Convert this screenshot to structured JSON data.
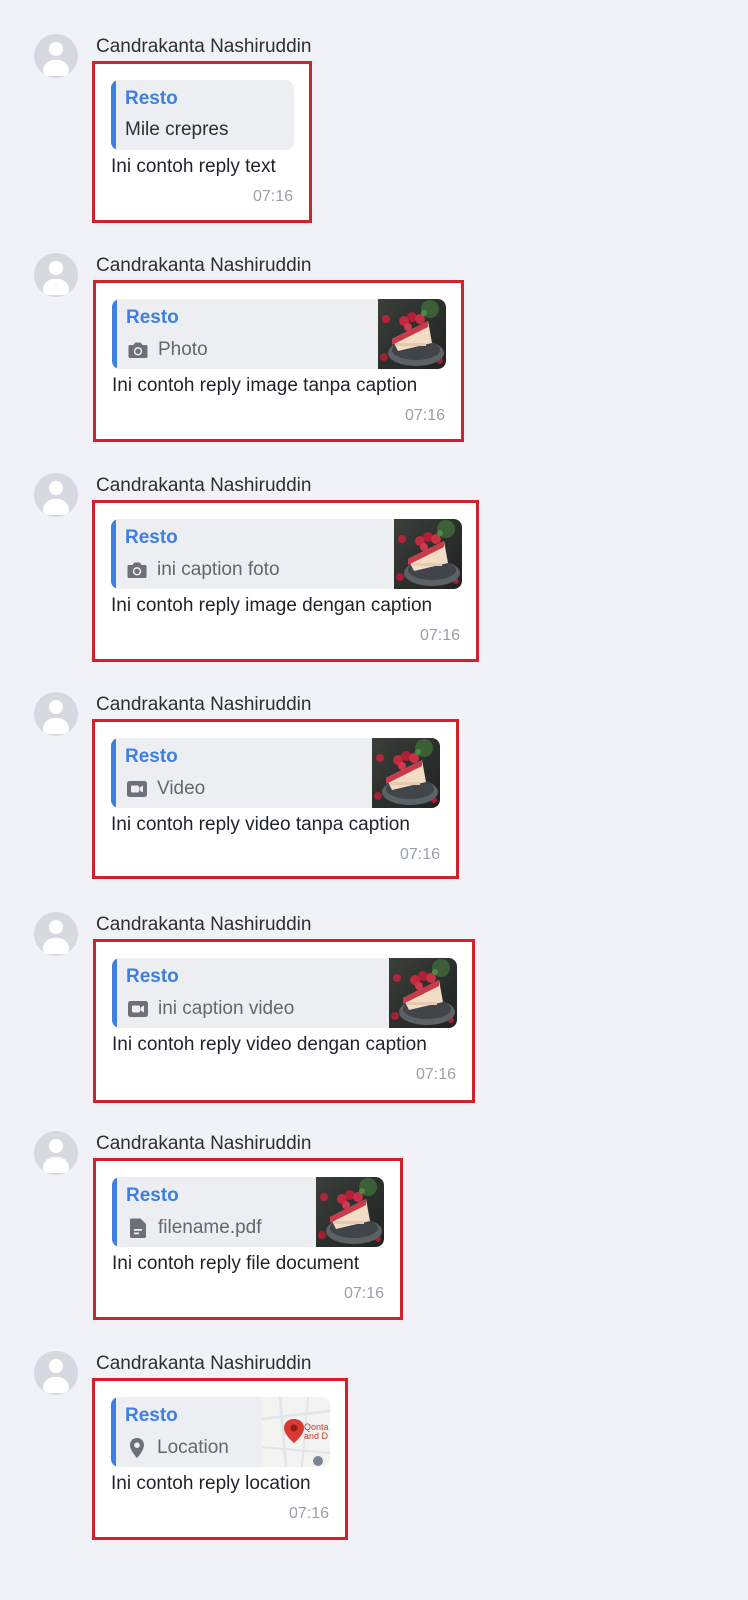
{
  "messages": [
    {
      "sender": "Candrakanta Nashiruddin",
      "reply_to": "Resto",
      "reply_preview": "Mile crepres",
      "reply_icon": "",
      "reply_thumb": "",
      "text": "Ini contoh reply text",
      "time": "07:16"
    },
    {
      "sender": "Candrakanta Nashiruddin",
      "reply_to": "Resto",
      "reply_preview": "Photo",
      "reply_icon": "camera-icon",
      "reply_thumb": "cake-photo",
      "text": "Ini contoh reply image tanpa caption",
      "time": "07:16"
    },
    {
      "sender": "Candrakanta Nashiruddin",
      "reply_to": "Resto",
      "reply_preview": "ini caption foto",
      "reply_icon": "camera-icon",
      "reply_thumb": "cake-photo",
      "text": "Ini contoh reply image dengan caption",
      "time": "07:16"
    },
    {
      "sender": "Candrakanta Nashiruddin",
      "reply_to": "Resto",
      "reply_preview": "Video",
      "reply_icon": "video-icon",
      "reply_thumb": "cake-photo",
      "text": "Ini contoh reply video tanpa caption",
      "time": "07:16"
    },
    {
      "sender": "Candrakanta Nashiruddin",
      "reply_to": "Resto",
      "reply_preview": "ini caption video",
      "reply_icon": "video-icon",
      "reply_thumb": "cake-photo",
      "text": "Ini contoh reply video dengan caption",
      "time": "07:16"
    },
    {
      "sender": "Candrakanta Nashiruddin",
      "reply_to": "Resto",
      "reply_preview": "filename.pdf",
      "reply_icon": "document-icon",
      "reply_thumb": "cake-photo",
      "text": "Ini contoh reply file document",
      "time": "07:16"
    },
    {
      "sender": "Candrakanta Nashiruddin",
      "reply_to": "Resto",
      "reply_preview": "Location",
      "reply_icon": "location-pin-icon",
      "reply_thumb": "map-snippet",
      "map_label": "Qontak and D",
      "text": "Ini contoh reply location",
      "time": "07:16"
    }
  ],
  "colors": {
    "background": "#f0f2f7",
    "bubble": "#ffffff",
    "reply_card": "#eceef2",
    "accent_blue": "#3f7fe0",
    "highlight_red": "#d4202c",
    "timestamp": "#9aa0a8"
  }
}
